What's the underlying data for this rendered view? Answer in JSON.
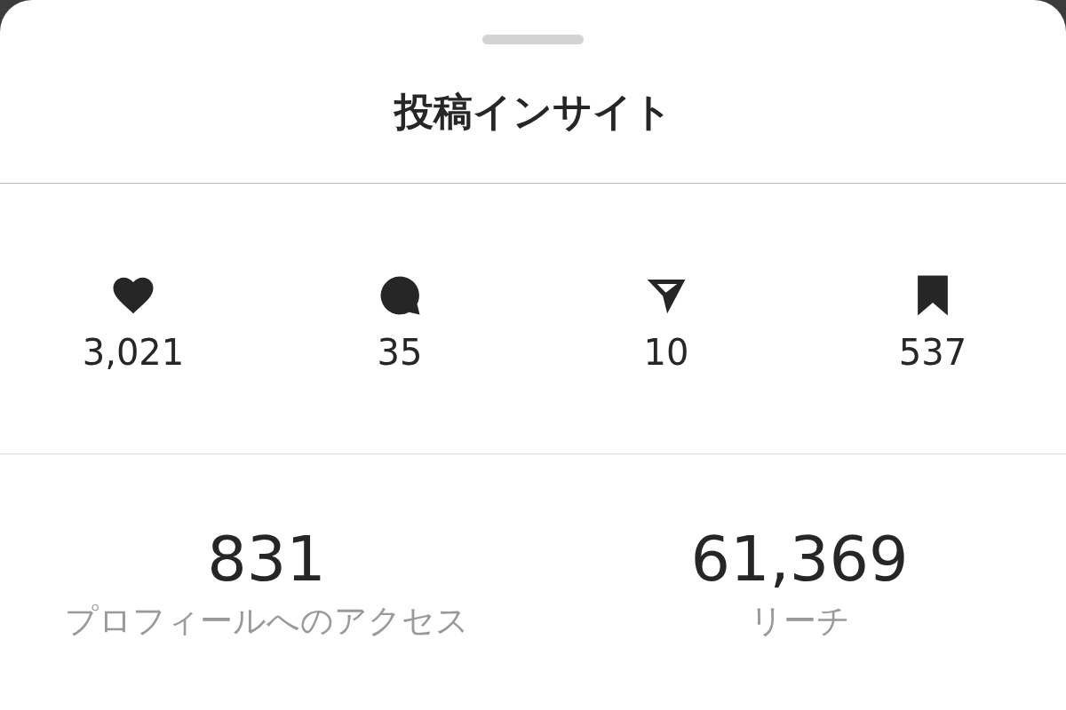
{
  "sheet": {
    "title": "投稿インサイト"
  },
  "interactions": [
    {
      "kind": "like",
      "value": "3,021"
    },
    {
      "kind": "comment",
      "value": "35"
    },
    {
      "kind": "share",
      "value": "10"
    },
    {
      "kind": "save",
      "value": "537"
    }
  ],
  "metrics": [
    {
      "value": "831",
      "label": "プロフィールへのアクセス"
    },
    {
      "value": "61,369",
      "label": "リーチ"
    }
  ]
}
